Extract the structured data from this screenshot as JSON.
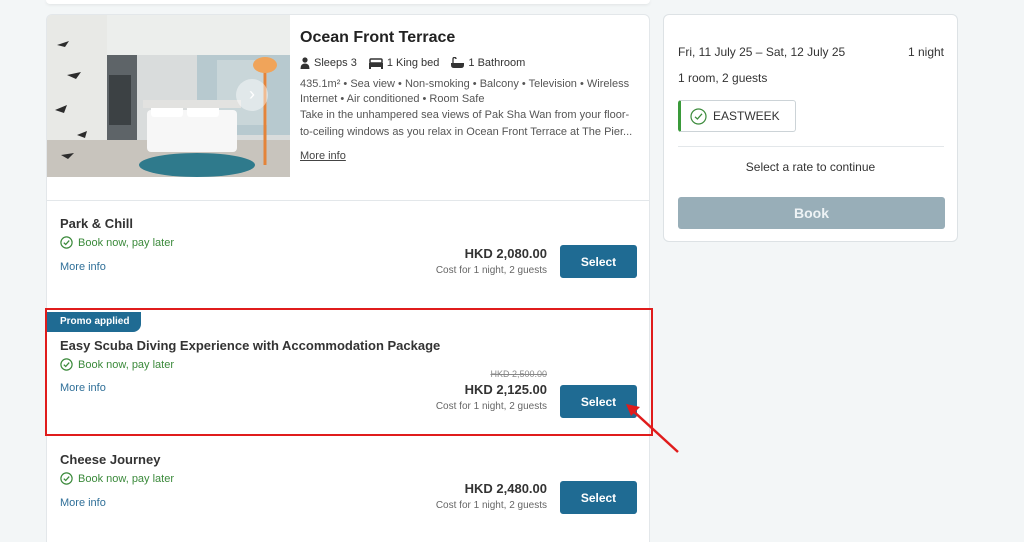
{
  "room": {
    "title": "Ocean Front Terrace",
    "features": [
      {
        "icon": "person-icon",
        "label": "Sleeps 3"
      },
      {
        "icon": "bed-icon",
        "label": "1 King bed"
      },
      {
        "icon": "bathtub-icon",
        "label": "1 Bathroom"
      }
    ],
    "amenities": [
      "435.1m²",
      "Sea view",
      "Non-smoking",
      "Balcony",
      "Television",
      "Wireless Internet",
      "Air conditioned",
      "Room Safe"
    ],
    "description": "Take in the unhampered sea views of Pak Sha Wan from your floor-to-ceiling windows as you relax in Ocean Front Terrace at The Pier...",
    "more_info": "More info",
    "photo_next_icon": "chevron-right-icon"
  },
  "rates": [
    {
      "name": "Park & Chill",
      "pay_later": "Book now, pay later",
      "more_info": "More info",
      "price": "HKD 2,080.00",
      "price_note": "Cost for 1 night, 2 guests",
      "select_label": "Select"
    },
    {
      "promo_tag": "Promo applied",
      "name": "Easy Scuba Diving Experience with Accommodation Package",
      "pay_later": "Book now, pay later",
      "more_info": "More info",
      "old_price": "HKD 2,500.00",
      "price": "HKD 2,125.00",
      "price_note": "Cost for 1 night, 2 guests",
      "select_label": "Select"
    },
    {
      "name": "Cheese Journey",
      "pay_later": "Book now, pay later",
      "more_info": "More info",
      "price": "HKD 2,480.00",
      "price_note": "Cost for 1 night, 2 guests",
      "select_label": "Select"
    }
  ],
  "summary": {
    "dates": "Fri, 11 July 25 – Sat, 12 July 25",
    "nights": "1 night",
    "guests": "1 room, 2 guests",
    "promo_code": "EASTWEEK",
    "hint": "Select a rate to continue",
    "book_label": "Book"
  },
  "colors": {
    "accent": "#1f6b93",
    "success": "#3b8a3b",
    "annotation": "#e01c1c",
    "book_disabled": "#98aeb8"
  }
}
